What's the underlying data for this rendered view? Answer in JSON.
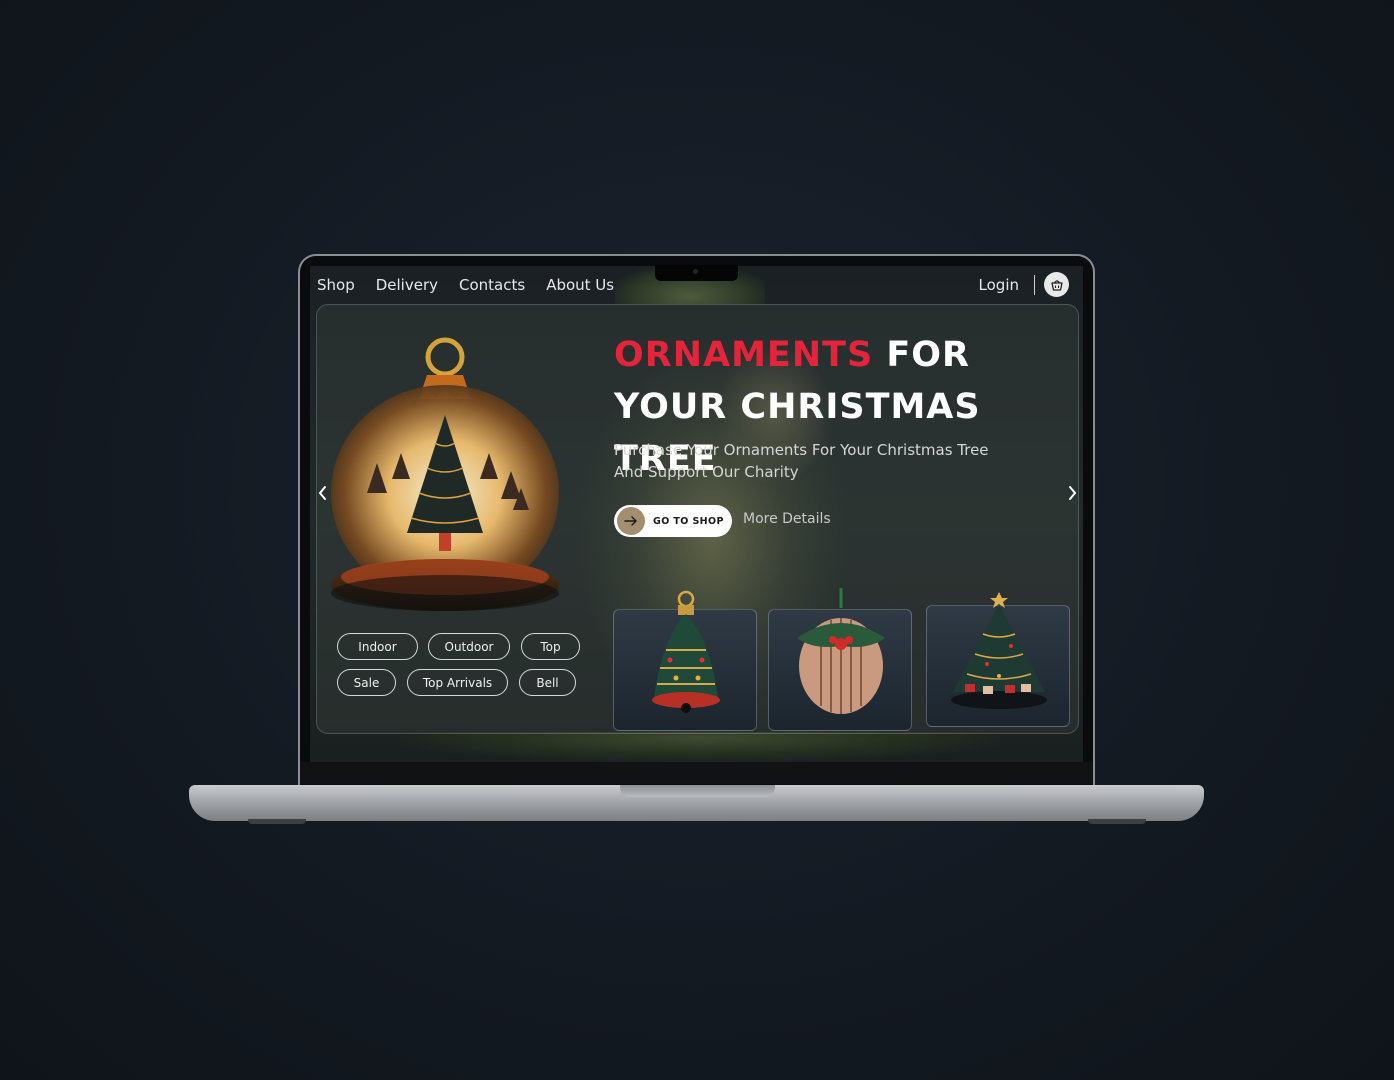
{
  "nav": {
    "links": [
      "Shop",
      "Delivery",
      "Contacts",
      "About Us"
    ],
    "login": "Login",
    "cart_icon": "basket-icon"
  },
  "hero": {
    "title_highlight": "ORNAMENTS",
    "title_rest_line1": " FOR",
    "title_line2": "YOUR CHRISTMAS TREE",
    "subtitle": "Purchase Your Ornaments For Your Christmas Tree And Support Our Charity",
    "cta_label": "GO TO SHOP",
    "more_label": "More Details"
  },
  "tags": [
    "Indoor",
    "Outdoor",
    "Top",
    "Sale",
    "Top Arrivals",
    "Bell"
  ],
  "products": [
    "bell-ornament",
    "ball-ornament",
    "tree-ornament"
  ],
  "colors": {
    "accent_red": "#e3243a",
    "cta_circle": "#a58d70",
    "background": "#141a22"
  }
}
